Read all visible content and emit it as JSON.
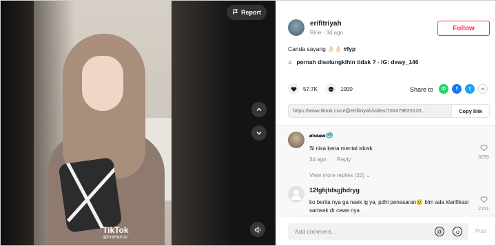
{
  "video": {
    "report_label": "Report",
    "watermark_logo": "TikTok",
    "watermark_user": "@ririefairus"
  },
  "author": {
    "username": "erifitriyah",
    "meta": "Ririe · 3d ago",
    "follow_label": "Follow"
  },
  "caption": {
    "text": "Canda sayang 👌🏻👌🏻 ",
    "hashtag": "#fyp"
  },
  "music": {
    "text": "pernah diselungkihin tidak ? - IG: dewy_146"
  },
  "stats": {
    "likes": "57.7K",
    "comments": "1000"
  },
  "share": {
    "label": "Share to",
    "targets": [
      {
        "name": "whatsapp",
        "color": "#25D366"
      },
      {
        "name": "facebook",
        "color": "#1877F2"
      },
      {
        "name": "twitter",
        "color": "#1DA1F2"
      },
      {
        "name": "embed",
        "color": "#161823"
      }
    ]
  },
  "link": {
    "url": "https://www.tiktok.com/@erifitriyah/video/702479823120...",
    "copy_label": "Copy link"
  },
  "comments": [
    {
      "name": "𝒶𝓇𝒶𝒶𝒶🥶",
      "text": "Si nisa kena mental wkwk",
      "date": "3d ago",
      "reply_label": "Reply",
      "likes": "3235"
    },
    {
      "name": "12fghjtdsgjhdryg",
      "text": "ko berita nya ga naek lg ya, pdhl penasaran😢 blm ada klarifikasi samsek dr cewe nya",
      "likes": "2151"
    }
  ],
  "view_more": "View more replies (32) ⌄",
  "composer": {
    "placeholder": "Add comment...",
    "mention_icon": "@",
    "post_label": "Post"
  },
  "colors": {
    "accent": "#fe2c55",
    "text": "#161823",
    "muted": "#8a8b91"
  }
}
